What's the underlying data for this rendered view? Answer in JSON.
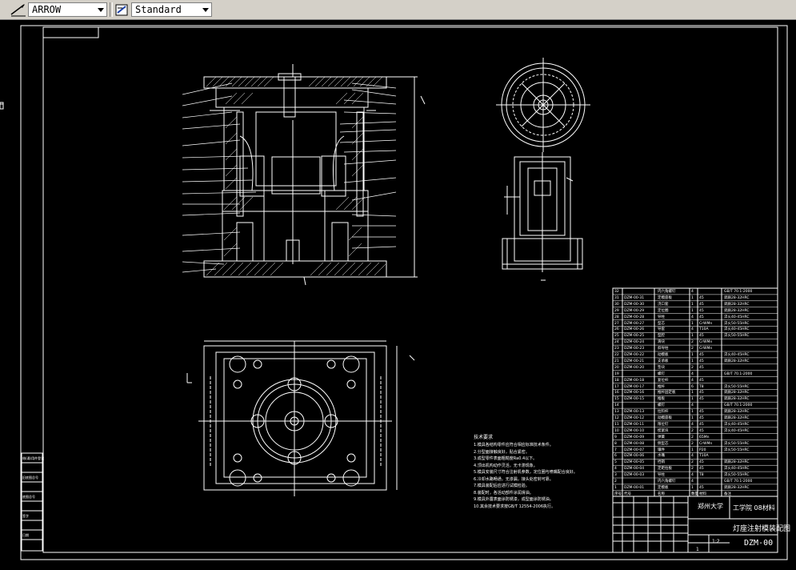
{
  "toolbar": {
    "dimstyle_value": "ARROW",
    "textstyle_value": "Standard"
  },
  "drawing": {
    "school": "工学院  08材料",
    "drawing_title": "灯座注射模装配图",
    "drawing_number": "DZM-00",
    "scale": "1:2",
    "sheet": "1",
    "org_label": "郑州大学"
  },
  "notes": {
    "title": "技术要求",
    "lines": [
      "1.模具各结构零件应符合相应标准技术条件。",
      "2.分型面接触良好，贴合紧密。",
      "3.成型零件表面粗糙度Ra0.4以下。",
      "4.顶出机构动作灵活，无卡滞现象。",
      "5.模具安装尺寸符合注射机参数，定位圈与喷嘴配合良好。",
      "6.冷却水路畅通，无渗漏，接头处密封可靠。",
      "7.模具装配后应进行试模检验。",
      "8.装配时，各活动部件涂润滑油。",
      "9.模具外露表面涂防锈漆，成型面涂防锈油。",
      "10.其余技术要求按GB/T 12554-2006执行。"
    ]
  },
  "bom": {
    "rows": [
      {
        "no": "32",
        "code": "",
        "name": "内六角螺钉",
        "qty": "4",
        "mat": "",
        "std": "GB/T 70.1-2000"
      },
      {
        "no": "31",
        "code": "DZM-00-31",
        "name": "定模座板",
        "qty": "1",
        "mat": "45",
        "std": "调质28-32HRC"
      },
      {
        "no": "30",
        "code": "DZM-00-30",
        "name": "浇口套",
        "qty": "1",
        "mat": "45",
        "std": "调质28-32HRC"
      },
      {
        "no": "29",
        "code": "DZM-00-29",
        "name": "定位圈",
        "qty": "1",
        "mat": "45",
        "std": "调质28-32HRC"
      },
      {
        "no": "28",
        "code": "DZM-00-28",
        "name": "导柱",
        "qty": "4",
        "mat": "45",
        "std": "淬火40-45HRC"
      },
      {
        "no": "27",
        "code": "DZM-00-27",
        "name": "型芯",
        "qty": "1",
        "mat": "CrWMn",
        "std": "淬火50-55HRC"
      },
      {
        "no": "26",
        "code": "DZM-00-26",
        "name": "导套",
        "qty": "4",
        "mat": "T10A",
        "std": "淬火40-45HRC"
      },
      {
        "no": "25",
        "code": "DZM-00-25",
        "name": "型腔",
        "qty": "1",
        "mat": "45",
        "std": "淬火50-55HRC"
      },
      {
        "no": "24",
        "code": "DZM-00-24",
        "name": "滑块",
        "qty": "2",
        "mat": "CrWMn",
        "std": ""
      },
      {
        "no": "23",
        "code": "DZM-00-23",
        "name": "斜导柱",
        "qty": "2",
        "mat": "CrWMn",
        "std": ""
      },
      {
        "no": "22",
        "code": "DZM-00-22",
        "name": "动模板",
        "qty": "1",
        "mat": "45",
        "std": "淬火40-45HRC"
      },
      {
        "no": "21",
        "code": "DZM-00-21",
        "name": "支承板",
        "qty": "1",
        "mat": "45",
        "std": "调质28-32HRC"
      },
      {
        "no": "20",
        "code": "DZM-00-20",
        "name": "垫块",
        "qty": "2",
        "mat": "45",
        "std": ""
      },
      {
        "no": "19",
        "code": "",
        "name": "螺钉",
        "qty": "4",
        "mat": "",
        "std": "GB/T 70.1-2000"
      },
      {
        "no": "18",
        "code": "DZM-00-18",
        "name": "复位杆",
        "qty": "4",
        "mat": "45",
        "std": ""
      },
      {
        "no": "17",
        "code": "DZM-00-17",
        "name": "推杆",
        "qty": "6",
        "mat": "T8",
        "std": "淬火50-55HRC"
      },
      {
        "no": "16",
        "code": "DZM-00-16",
        "name": "推杆固定板",
        "qty": "1",
        "mat": "45",
        "std": "调质28-32HRC"
      },
      {
        "no": "15",
        "code": "DZM-00-15",
        "name": "推板",
        "qty": "1",
        "mat": "45",
        "std": "调质28-32HRC"
      },
      {
        "no": "14",
        "code": "",
        "name": "螺钉",
        "qty": "4",
        "mat": "",
        "std": "GB/T 70.1-2000"
      },
      {
        "no": "13",
        "code": "DZM-00-13",
        "name": "拉料杆",
        "qty": "1",
        "mat": "45",
        "std": "调质28-32HRC"
      },
      {
        "no": "12",
        "code": "DZM-00-12",
        "name": "动模座板",
        "qty": "1",
        "mat": "45",
        "std": "调质28-32HRC"
      },
      {
        "no": "11",
        "code": "DZM-00-11",
        "name": "限位钉",
        "qty": "4",
        "mat": "45",
        "std": "淬火40-45HRC"
      },
      {
        "no": "10",
        "code": "DZM-00-10",
        "name": "楔紧块",
        "qty": "2",
        "mat": "45",
        "std": "淬火40-45HRC"
      },
      {
        "no": "9",
        "code": "DZM-00-09",
        "name": "弹簧",
        "qty": "2",
        "mat": "65Mn",
        "std": ""
      },
      {
        "no": "8",
        "code": "DZM-00-08",
        "name": "侧型芯",
        "qty": "2",
        "mat": "CrWMn",
        "std": "淬火50-55HRC"
      },
      {
        "no": "7",
        "code": "DZM-00-07",
        "name": "镶件",
        "qty": "1",
        "mat": "P20",
        "std": "淬火50-55HRC"
      },
      {
        "no": "6",
        "code": "DZM-00-06",
        "name": "水嘴",
        "qty": "4",
        "mat": "T10A",
        "std": ""
      },
      {
        "no": "5",
        "code": "DZM-00-05",
        "name": "挡销",
        "qty": "2",
        "mat": "45",
        "std": "调质28-32HRC"
      },
      {
        "no": "4",
        "code": "DZM-00-04",
        "name": "定距拉板",
        "qty": "2",
        "mat": "45",
        "std": "淬火40-45HRC"
      },
      {
        "no": "3",
        "code": "DZM-00-03",
        "name": "导柱",
        "qty": "4",
        "mat": "T8",
        "std": "淬火50-55HRC"
      },
      {
        "no": "2",
        "code": "",
        "name": "内六角螺钉",
        "qty": "4",
        "mat": "",
        "std": "GB/T 70.1-2000"
      },
      {
        "no": "1",
        "code": "DZM-00-01",
        "name": "定模板",
        "qty": "1",
        "mat": "45",
        "std": "调质28-32HRC"
      }
    ],
    "header": {
      "no": "序号",
      "code": "代号",
      "name": "名称",
      "qty": "数量",
      "mat": "材料",
      "std": "备注"
    }
  },
  "left_strip": {
    "labels": [
      "借(通)用件登记",
      "旧底图总号",
      "底图总号",
      "签字",
      "日期"
    ]
  },
  "colors": {
    "background": "#000000",
    "lines": "#ffffff",
    "toolbar": "#d4d0c8"
  },
  "icons": [
    "dimension-style-icon",
    "text-style-icon"
  ]
}
